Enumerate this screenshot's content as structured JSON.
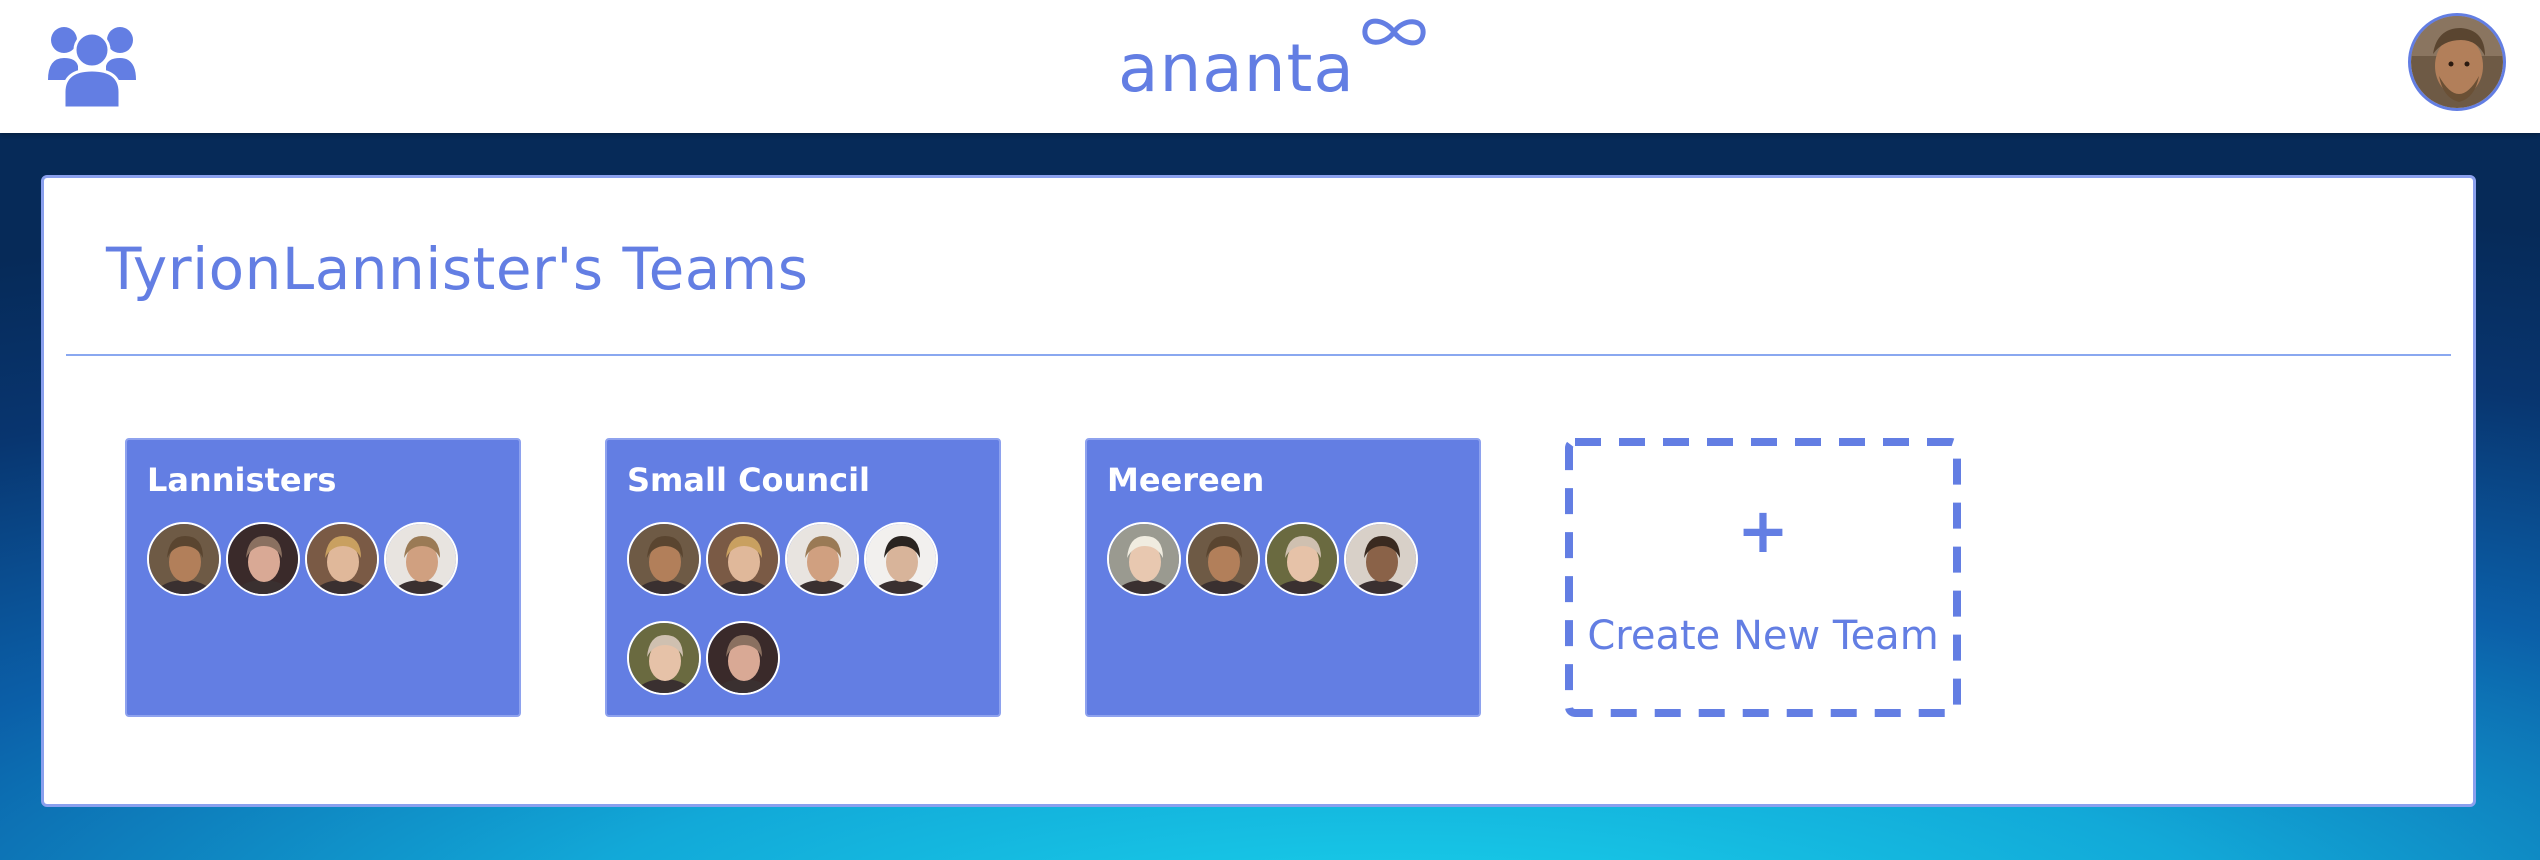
{
  "header": {
    "logo_text": "ananta",
    "logo_symbol": "infinity-icon",
    "left_icon": "users-group-icon",
    "right_icon": "user-avatar"
  },
  "page": {
    "title": "TyrionLannister's Teams"
  },
  "teams": [
    {
      "name": "Lannisters",
      "members": [
        {
          "avatar": "tyrion-avatar",
          "skin": "#b27f5a",
          "hair": "#5a4530",
          "bg": "#6e5a45"
        },
        {
          "avatar": "tywin-avatar",
          "skin": "#d9a995",
          "hair": "#8a7060",
          "bg": "#3a2a2a"
        },
        {
          "avatar": "cersei-avatar",
          "skin": "#e0b89a",
          "hair": "#c9a060",
          "bg": "#7a5a45"
        },
        {
          "avatar": "jaime-avatar",
          "skin": "#d0a080",
          "hair": "#9a7a55",
          "bg": "#e8e4e0"
        }
      ]
    },
    {
      "name": "Small Council",
      "members": [
        {
          "avatar": "tyrion-avatar",
          "skin": "#b27f5a",
          "hair": "#5a4530",
          "bg": "#6e5a45"
        },
        {
          "avatar": "cersei-avatar",
          "skin": "#e0b89a",
          "hair": "#c9a060",
          "bg": "#7a5a45"
        },
        {
          "avatar": "jaime-avatar",
          "skin": "#d0a080",
          "hair": "#9a7a55",
          "bg": "#e8e4e0"
        },
        {
          "avatar": "littlefinger-avatar",
          "skin": "#d8b49a",
          "hair": "#2a2420",
          "bg": "#f2f0ee"
        },
        {
          "avatar": "varys-avatar",
          "skin": "#e6c2a8",
          "hair": "#cfc0b0",
          "bg": "#6a6a40"
        },
        {
          "avatar": "tywin-avatar",
          "skin": "#d9a995",
          "hair": "#8a7060",
          "bg": "#3a2a2a"
        }
      ]
    },
    {
      "name": "Meereen",
      "members": [
        {
          "avatar": "daenerys-avatar",
          "skin": "#e8c8b0",
          "hair": "#f0ece0",
          "bg": "#9a9a90"
        },
        {
          "avatar": "tyrion-avatar",
          "skin": "#b27f5a",
          "hair": "#5a4530",
          "bg": "#6e5a45"
        },
        {
          "avatar": "varys-avatar",
          "skin": "#e6c2a8",
          "hair": "#cfc0b0",
          "bg": "#6a6a40"
        },
        {
          "avatar": "grey-worm-avatar",
          "skin": "#8a6248",
          "hair": "#3a2a20",
          "bg": "#d8d0c8"
        }
      ]
    }
  ],
  "create_card": {
    "plus": "+",
    "label": "Create New Team"
  },
  "colors": {
    "accent": "#637ee3",
    "card_border": "#8ea2ee"
  }
}
